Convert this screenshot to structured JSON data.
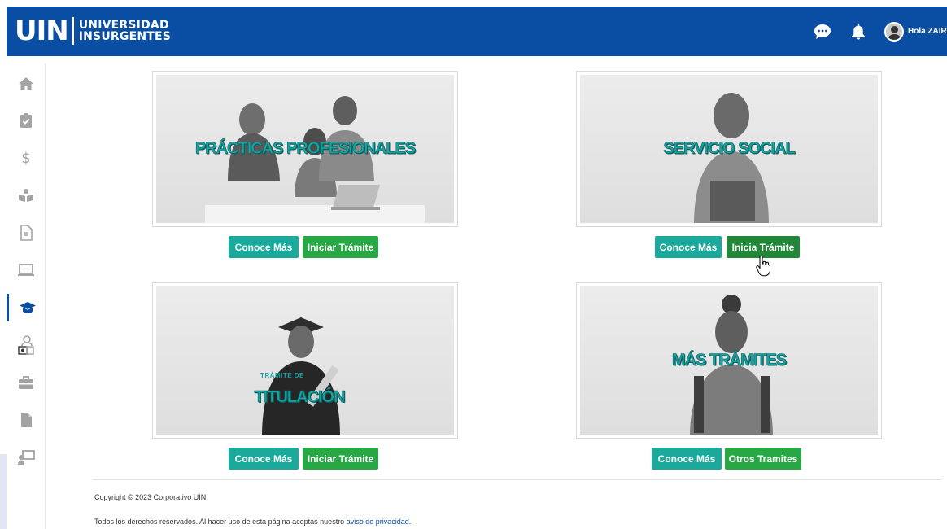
{
  "header": {
    "logo_mark": "UIN",
    "logo_line1": "UNIVERSIDAD",
    "logo_line2": "INSURGENTES",
    "greeting": "Hola ZAIRA D",
    "icons": [
      "chat-icon",
      "bell-icon",
      "user-avatar"
    ]
  },
  "sidebar": {
    "items": [
      {
        "icon": "home-icon"
      },
      {
        "icon": "clipboard-check-icon"
      },
      {
        "icon": "dollar-icon"
      },
      {
        "icon": "reading-icon"
      },
      {
        "icon": "document-icon"
      },
      {
        "icon": "laptop-icon"
      },
      {
        "icon": "graduation-cap-icon",
        "active": true
      },
      {
        "icon": "scholarship-icon"
      },
      {
        "icon": "briefcase-icon"
      },
      {
        "icon": "file-icon"
      },
      {
        "icon": "teacher-board-icon"
      }
    ]
  },
  "cards": [
    {
      "title": "PRÁCTICAS PROFESIONALES",
      "btn1": "Conoce Más",
      "btn2": "Iniciar Trámite"
    },
    {
      "title": "SERVICIO SOCIAL",
      "btn1": "Conoce Más",
      "btn2": "Inicia Trámite"
    },
    {
      "subtitle": "TRÁMITE DE",
      "title": "TITULACIÓN",
      "btn1": "Conoce Más",
      "btn2": "Iniciar Trámite"
    },
    {
      "title": "MÁS TRÁMITES",
      "btn1": "Conoce Más",
      "btn2": "Otros Tramites"
    }
  ],
  "footer": {
    "copyright": "Copyright © 2023 Corporativo UIN",
    "rights": "Todos los derechos reservados. Al hacer uso de esta página aceptas nuestro",
    "privacy_link": "aviso de privacidad",
    "period": "."
  },
  "colors": {
    "header": "#0a4ea3",
    "teal_button": "#1aa99b",
    "green_button": "#28a745",
    "title_teal": "#1aa2a0"
  }
}
